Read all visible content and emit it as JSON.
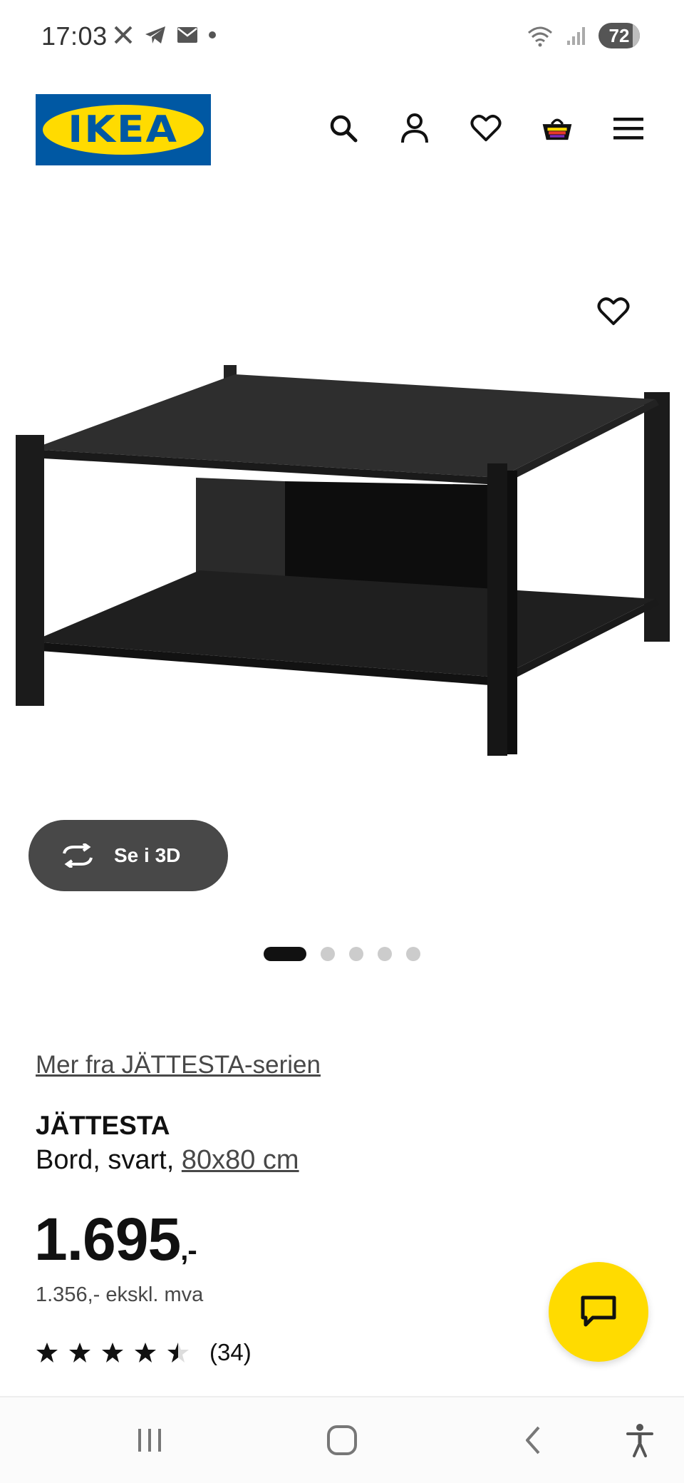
{
  "status_bar": {
    "time": "17:03",
    "left_icons": [
      "x-icon",
      "telegram-icon",
      "mail-icon",
      "dot-icon"
    ],
    "right_icons": [
      "wifi-icon",
      "signal-icon"
    ],
    "battery": "72"
  },
  "header": {
    "logo_text": "IKEA",
    "icons": [
      "search-icon",
      "user-icon",
      "heart-icon",
      "cart-icon",
      "menu-icon"
    ]
  },
  "gallery": {
    "view_3d_label": "Se i 3D",
    "image_count": 5,
    "active_image": 1
  },
  "product": {
    "series_link": "Mer fra JÄTTESTA-serien",
    "name": "JÄTTESTA",
    "description": "Bord, svart, ",
    "size_link": "80x80 cm",
    "price": "1.695",
    "price_suffix": ",-",
    "price_ex_vat": "1.356,- ekskl. mva",
    "rating": 4.5,
    "rating_max": 5,
    "review_count": "(34)"
  },
  "colors": {
    "ikea_blue": "#0058a3",
    "ikea_yellow": "#ffdb00",
    "dark_button": "#484848"
  },
  "nav_bar": {
    "buttons": [
      "recent-apps-icon",
      "home-icon",
      "back-icon",
      "accessibility-icon"
    ]
  }
}
